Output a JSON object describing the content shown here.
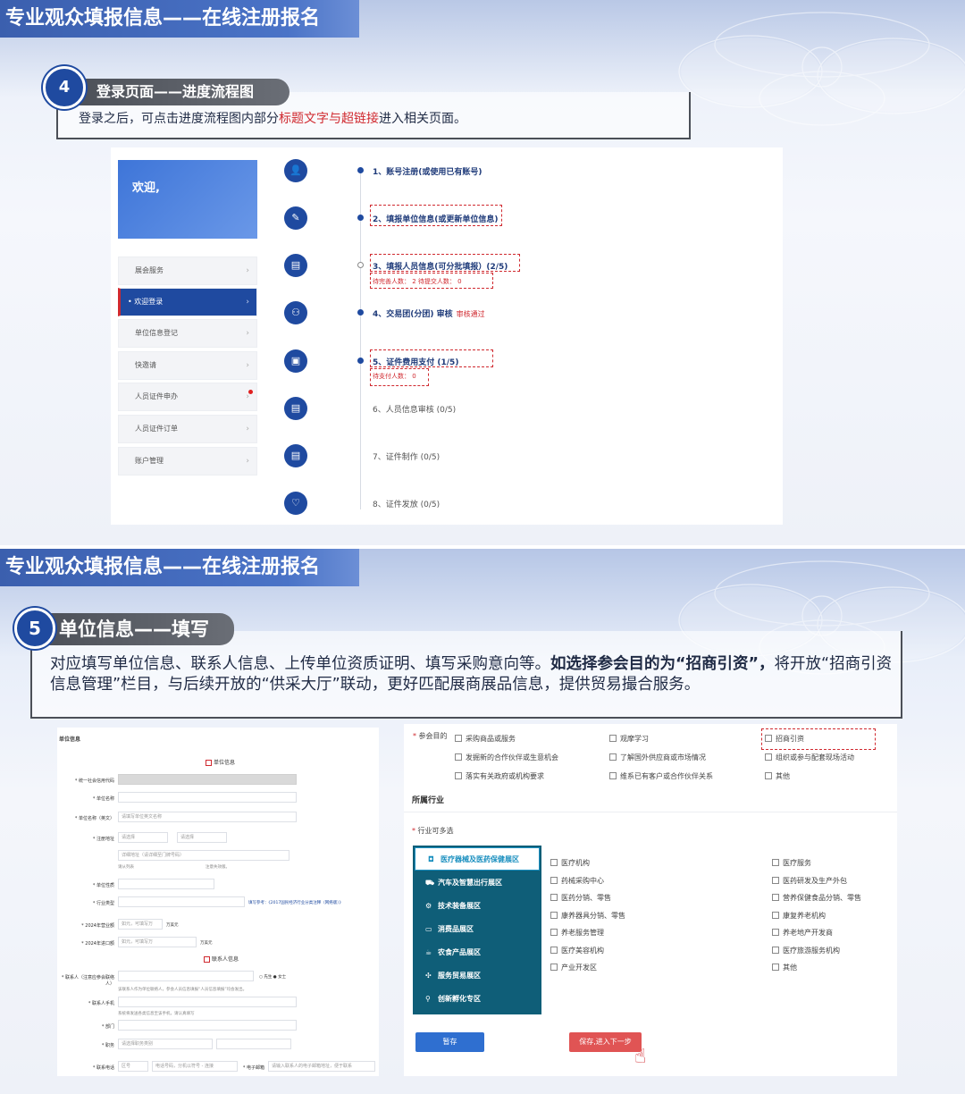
{
  "slide1": {
    "title": "专业观众填报信息——在线注册报名",
    "step_number": "4",
    "step_title": "登录页面——进度流程图",
    "desc_prefix": "登录之后，可点击进度流程图内部分",
    "desc_highlight": "标题文字与超链接",
    "desc_suffix": "进入相关页面。",
    "welcome": "欢迎,",
    "menu": [
      {
        "label": "展会服务"
      },
      {
        "label": "欢迎登录"
      },
      {
        "label": "单位信息登记"
      },
      {
        "label": "快邀请"
      },
      {
        "label": "人员证件申办"
      },
      {
        "label": "人员证件订单"
      },
      {
        "label": "账户管理"
      }
    ],
    "flow": [
      {
        "label": "1、账号注册(或使用已有账号)"
      },
      {
        "label": "2、填报单位信息(或更新单位信息)"
      },
      {
        "label": "3、填报人员信息(可分批填报）(2/5)",
        "sub": "待完善人数： 2     待提交人数： 0"
      },
      {
        "label": "4、交易团(分团) 审核",
        "tag": "审核通过"
      },
      {
        "label": "5、证件费用支付 (1/5)",
        "sub": "待支付人数： 0"
      },
      {
        "label": "6、人员信息审核 (0/5)"
      },
      {
        "label": "7、证件制作 (0/5)"
      },
      {
        "label": "8、证件发放 (0/5)"
      }
    ]
  },
  "slide2": {
    "title": "专业观众填报信息——在线注册报名",
    "step_number": "5",
    "step_title": "单位信息——填写",
    "desc_normal": "对应填写单位信息、联系人信息、上传单位资质证明、填写采购意向等。",
    "desc_bold": "如选择参会目的为“招商引资”，",
    "desc_rest": "将开放“招商引资信息管理”栏目，与后续开放的“供采大厅”联动，更好匹配展商展品信息，提供贸易撮合服务。",
    "left_form": {
      "title": "单位信息",
      "section_unit": "单位信息",
      "section_contact": "联系人信息",
      "fields": {
        "credit_code": "* 统一社会信用代码",
        "unit_name": "* 单位名称",
        "unit_name_en": "* 单位名称（英文）",
        "reg_addr": "* 注册地址",
        "unit_type": "* 单位性质",
        "industry": "* 行业类型",
        "revenue": "* 2024年营业额",
        "import": "* 2024年进口额",
        "contact": "* 联系人（注意应参会联络人）",
        "phone": "* 联系人手机",
        "dept": "* 部门",
        "position": "* 职务",
        "tel": "* 联系电话",
        "email": "* 电子邮箱"
      },
      "placeholders": {
        "unit_name_en": "请填写单位英文名称",
        "province": "请选择",
        "city": "请选择",
        "detail_addr": "详细地址（请详细至门牌号码）",
        "revenue": "如元，可填写万",
        "import": "如元，可填写万",
        "position": "请选择职务类别",
        "tel": "区号",
        "tel_num": "电话号码，分机以符号 - 连接",
        "email": "请输入联系人的电子邮箱地址，便于联系"
      },
      "unit_wan": "万美元",
      "unit_wan2": "万美元",
      "industry_link": "填写参考：《2017国民经济行业分类注释（网络版）》",
      "gender_m": "先生",
      "gender_f": "女士",
      "note_addr1": "请从列表",
      "note_addr2": "注意失效版。",
      "note_contact": "该联系人作为单位联络人，参会人员信息填报“人员信息填报”均会发出。",
      "note_phone": "系统将发送各类信息至该手机，请认真填写"
    },
    "right_form": {
      "purpose_label": "参会目的",
      "purposes": [
        "采购商品或服务",
        "观摩学习",
        "招商引资",
        "发掘新的合作伙伴或生意机会",
        "了解国外供应商或市场情况",
        "组织或参与配套现场活动",
        "落实有关政府或机构要求",
        "维系已有客户或合作伙伴关系",
        "其他"
      ],
      "industry_title": "所属行业",
      "industry_sub": "行业可多选",
      "categories": [
        {
          "icon": "◘",
          "label": "医疗器械及医药保健展区"
        },
        {
          "icon": "⛟",
          "label": "汽车及智慧出行展区"
        },
        {
          "icon": "⚙",
          "label": "技术装备展区"
        },
        {
          "icon": "▭",
          "label": "消费品展区"
        },
        {
          "icon": "☕",
          "label": "农食产品展区"
        },
        {
          "icon": "✣",
          "label": "服务贸易展区"
        },
        {
          "icon": "⚲",
          "label": "创新孵化专区"
        }
      ],
      "options_col1": [
        "医疗机构",
        "药械采购中心",
        "医药分销、零售",
        "康养器具分销、零售",
        "养老服务管理",
        "医疗美容机构",
        "产业开发区"
      ],
      "options_col2": [
        "医疗服务",
        "医药研发及生产外包",
        "营养保健食品分销、零售",
        "康复养老机构",
        "养老地产开发商",
        "医疗旅游服务机构",
        "其他"
      ],
      "btn_save": "暂存",
      "btn_next": "保存,进入下一步"
    }
  },
  "colors": {
    "primary": "#1f4aa0",
    "accent_red": "#d0292f",
    "category_panel": "#0f5e78",
    "title_bar": "#3b5fae"
  }
}
